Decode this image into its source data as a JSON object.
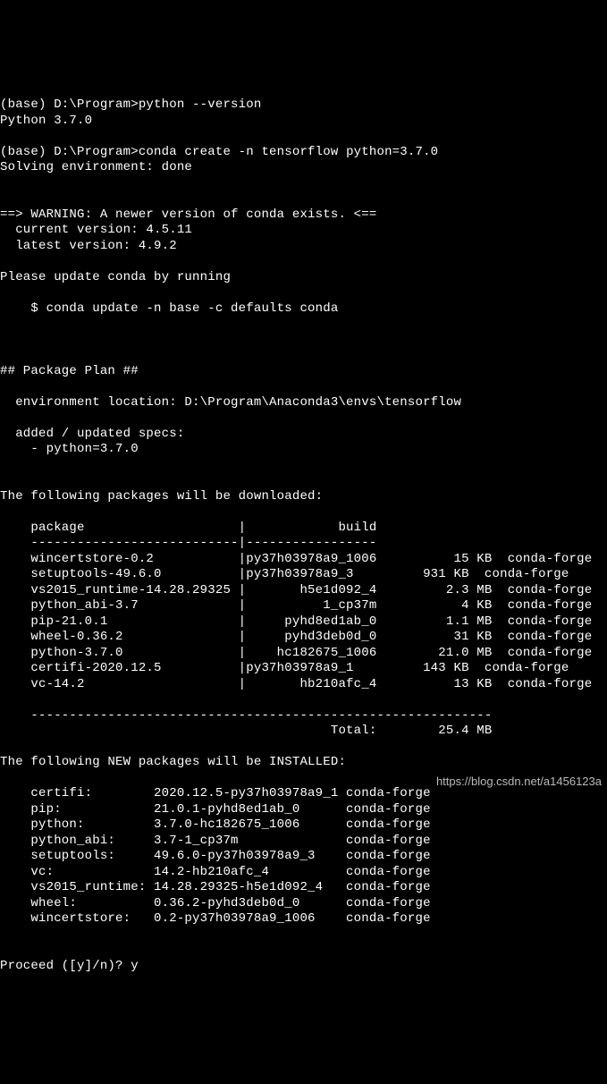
{
  "prompt1_path": "(base) D:\\Program>",
  "cmd1": "python --version",
  "py_version": "Python 3.7.0",
  "prompt2_path": "(base) D:\\Program>",
  "cmd2": "conda create -n tensorflow python=3.7.0",
  "solving": "Solving environment: done",
  "warn_hdr": "==> WARNING: A newer version of conda exists. <==",
  "cur_ver": "  current version: 4.5.11",
  "lat_ver": "  latest version: 4.9.2",
  "pls_update": "Please update conda by running",
  "update_cmd": "    $ conda update -n base -c defaults conda",
  "plan_hdr": "## Package Plan ##",
  "env_loc": "  environment location: D:\\Program\\Anaconda3\\envs\\tensorflow",
  "added_specs_hdr": "  added / updated specs:",
  "added_spec1": "    - python=3.7.0",
  "dl_hdr": "The following packages will be downloaded:",
  "tbl_hdr": "    package                    |            build",
  "tbl_rule": "    ---------------------------|-----------------",
  "pkg_rows": [
    "    wincertstore-0.2           |py37h03978a9_1006          15 KB  conda-forge",
    "    setuptools-49.6.0          |py37h03978a9_3         931 KB  conda-forge",
    "    vs2015_runtime-14.28.29325 |       h5e1d092_4         2.3 MB  conda-forge",
    "    python_abi-3.7             |          1_cp37m           4 KB  conda-forge",
    "    pip-21.0.1                 |     pyhd8ed1ab_0         1.1 MB  conda-forge",
    "    wheel-0.36.2               |     pyhd3deb0d_0          31 KB  conda-forge",
    "    python-3.7.0               |    hc182675_1006        21.0 MB  conda-forge",
    "    certifi-2020.12.5          |py37h03978a9_1         143 KB  conda-forge",
    "    vc-14.2                    |       hb210afc_4          13 KB  conda-forge"
  ],
  "tbl_end_rule": "    ------------------------------------------------------------",
  "total_line": "                                           Total:        25.4 MB",
  "new_hdr": "The following NEW packages will be INSTALLED:",
  "new_rows": [
    "    certifi:        2020.12.5-py37h03978a9_1 conda-forge",
    "    pip:            21.0.1-pyhd8ed1ab_0      conda-forge",
    "    python:         3.7.0-hc182675_1006      conda-forge",
    "    python_abi:     3.7-1_cp37m              conda-forge",
    "    setuptools:     49.6.0-py37h03978a9_3    conda-forge",
    "    vc:             14.2-hb210afc_4          conda-forge",
    "    vs2015_runtime: 14.28.29325-h5e1d092_4   conda-forge",
    "    wheel:          0.36.2-pyhd3deb0d_0      conda-forge",
    "    wincertstore:   0.2-py37h03978a9_1006    conda-forge"
  ],
  "proceed_prompt": "Proceed ([y]/n)? ",
  "proceed_answer": "y",
  "watermark": "https://blog.csdn.net/a1456123a"
}
